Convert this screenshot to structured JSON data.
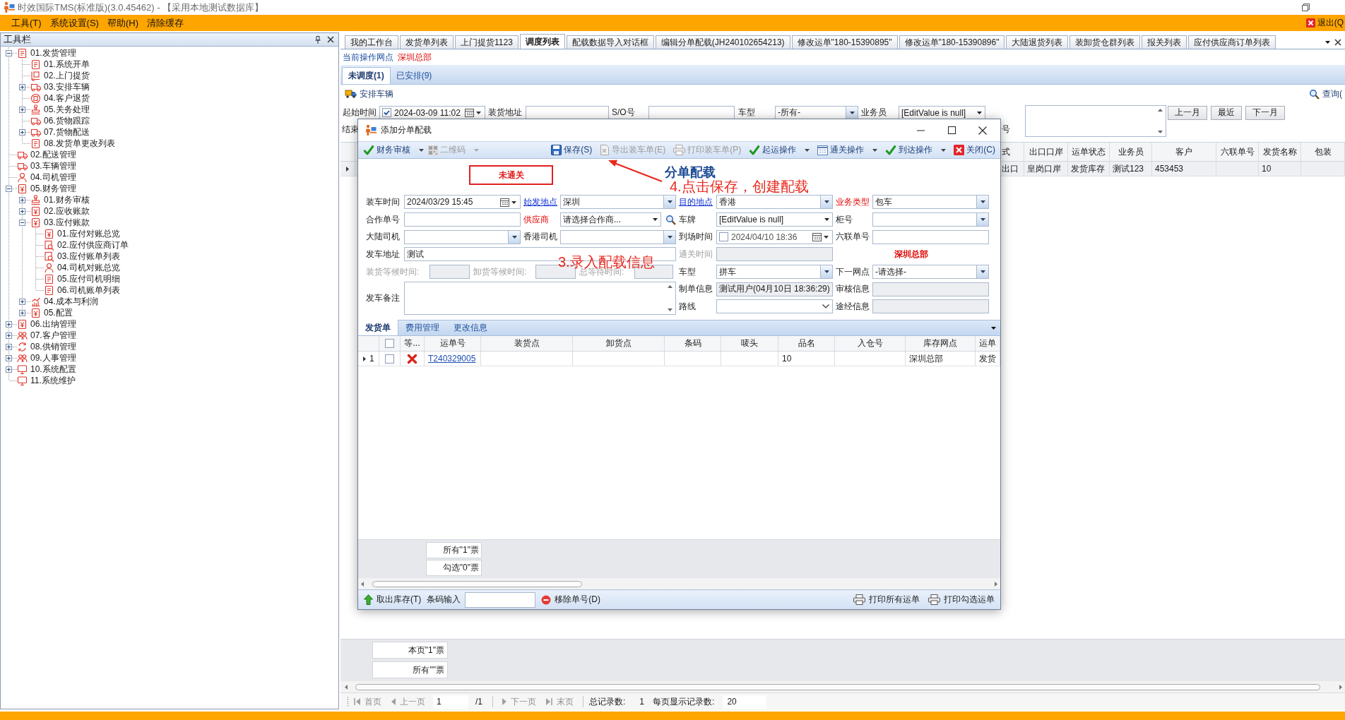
{
  "window": {
    "title": "时效国际TMS(标准版)(3.0.45462) - 【采用本地测试数据库】"
  },
  "menu": {
    "items": [
      "工具(T)",
      "系统设置(S)",
      "帮助(H)",
      "清除缓存"
    ],
    "exit": "退出(Q"
  },
  "toolbox": {
    "title": "工具栏",
    "tree": [
      {
        "label": "01.发货管理",
        "kind": "document",
        "expanded": true,
        "children": [
          {
            "label": "01.系统开单",
            "kind": "document"
          },
          {
            "label": "02.上门提货",
            "kind": "package"
          },
          {
            "label": "03.安排车辆",
            "kind": "truck",
            "expanded": false
          },
          {
            "label": "04.客户退货",
            "kind": "circle"
          },
          {
            "label": "05.关务处理",
            "kind": "stamp",
            "expanded": false
          },
          {
            "label": "06.货物跟踪",
            "kind": "truck"
          },
          {
            "label": "07.货物配送",
            "kind": "truck",
            "expanded": false
          },
          {
            "label": "08.发货单更改列表",
            "kind": "document"
          }
        ]
      },
      {
        "label": "02.配送管理",
        "kind": "truck"
      },
      {
        "label": "03.车辆管理",
        "kind": "truck"
      },
      {
        "label": "04.司机管理",
        "kind": "person"
      },
      {
        "label": "05.财务管理",
        "kind": "yen",
        "expanded": true,
        "children": [
          {
            "label": "01.财务审核",
            "kind": "stamp",
            "expanded": false
          },
          {
            "label": "02.应收账款",
            "kind": "yen",
            "expanded": false
          },
          {
            "label": "03.应付账款",
            "kind": "yen",
            "expanded": true,
            "children": [
              {
                "label": "01.应付对账总览",
                "kind": "yen"
              },
              {
                "label": "02.应付供应商订单",
                "kind": "search"
              },
              {
                "label": "03.应付账单列表",
                "kind": "search"
              },
              {
                "label": "04.司机对账总览",
                "kind": "person"
              },
              {
                "label": "05.应付司机明细",
                "kind": "document"
              },
              {
                "label": "06.司机账单列表",
                "kind": "document"
              }
            ]
          },
          {
            "label": "04.成本与利润",
            "kind": "chart",
            "expanded": false
          },
          {
            "label": "05.配置",
            "kind": "yen",
            "expanded": false
          }
        ]
      },
      {
        "label": "06.出纳管理",
        "kind": "yen",
        "expanded": false
      },
      {
        "label": "07.客户管理",
        "kind": "people",
        "expanded": false
      },
      {
        "label": "08.供销管理",
        "kind": "cycle",
        "expanded": false
      },
      {
        "label": "09.人事管理",
        "kind": "people",
        "expanded": false
      },
      {
        "label": "10.系统配置",
        "kind": "monitor",
        "expanded": false
      },
      {
        "label": "11.系统维护",
        "kind": "monitor"
      }
    ]
  },
  "tabs": [
    {
      "label": "我的工作台",
      "selected": false
    },
    {
      "label": "发货单列表",
      "selected": false
    },
    {
      "label": "上门提货1123",
      "selected": false
    },
    {
      "label": "调度列表",
      "selected": true
    },
    {
      "label": "配载数据导入对话框",
      "selected": false
    },
    {
      "label": "编辑分单配载(JH240102654213)",
      "selected": false
    },
    {
      "label": "修改运单\"180-15390895\"",
      "selected": false
    },
    {
      "label": "修改运单\"180-15390896\"",
      "selected": false
    },
    {
      "label": "大陆退货列表",
      "selected": false
    },
    {
      "label": "装卸货仓群列表",
      "selected": false
    },
    {
      "label": "报关列表",
      "selected": false
    },
    {
      "label": "应付供应商订单列表",
      "selected": false
    }
  ],
  "current_site": {
    "label": "当前操作网点",
    "value": "深圳总部"
  },
  "view_tabs": [
    {
      "label": "未调度(1)",
      "selected": true
    },
    {
      "label": "已安排(9)",
      "selected": false
    }
  ],
  "toolbar": {
    "arrange": "安排车辆",
    "query": "查询("
  },
  "filters": {
    "start": {
      "label": "起始时间",
      "kind": "date",
      "checked": true,
      "value": "2024-03-09 11:02"
    },
    "address": {
      "label": "装货地址",
      "kind": "text"
    },
    "so_number": {
      "label": "S/O号",
      "kind": "text"
    },
    "vehicle_type": {
      "label": "车型",
      "kind": "combo",
      "value": "-所有-"
    },
    "salesperson": {
      "label": "业务员",
      "kind": "dropdown",
      "value": "[EditValue is null]"
    },
    "end": {
      "label": "结束"
    },
    "number": {
      "label": "号",
      "kind": "memo"
    },
    "month_buttons": [
      "上一月",
      "最近",
      "下一月"
    ]
  },
  "grid": {
    "columns": [
      "式",
      "出口口岸",
      "运单状态",
      "业务员",
      "客户",
      "六联单号",
      "发货名称",
      "包装"
    ],
    "rows": [
      {
        "cells": [
          "出口",
          "皇岗口岸",
          "发货库存",
          "测试123",
          "453453",
          null,
          "10",
          null
        ]
      }
    ]
  },
  "summary": [
    "本页\"1\"票",
    "所有\"\"票"
  ],
  "pager": {
    "nav": [
      {
        "label": "首页",
        "kind": "first",
        "disabled": true
      },
      {
        "label": "上一页",
        "kind": "previous",
        "disabled": true
      },
      {
        "label": "下一页",
        "kind": "next",
        "disabled": true
      },
      {
        "label": "末页",
        "kind": "last",
        "disabled": true
      }
    ],
    "page": "1",
    "page_count": "/1",
    "total_label": "总记录数:",
    "total": "1",
    "page_size_label": "每页显示记录数:",
    "page_size": "20"
  },
  "dialog": {
    "title": "添加分单配载",
    "toolbar": [
      {
        "label": "财务审核",
        "kind": "check",
        "dropdown": true
      },
      {
        "label": "二维码",
        "kind": "qr",
        "disabled": true,
        "dropdown": true
      },
      {
        "label": "保存(S)",
        "kind": "save"
      },
      {
        "label": "导出装车单(E)",
        "kind": "export",
        "disabled": true
      },
      {
        "label": "打印装车单(P)",
        "kind": "print",
        "disabled": true
      },
      {
        "label": "起运操作",
        "kind": "check",
        "dropdown": true
      },
      {
        "label": "通关操作",
        "kind": "calendar",
        "dropdown": true
      },
      {
        "label": "到达操作",
        "kind": "check",
        "dropdown": true
      },
      {
        "label": "关闭(C)",
        "kind": "close"
      }
    ],
    "customs_status": "未通关",
    "heading": "分单配载",
    "form": {
      "load_time": {
        "label": "装车时间",
        "kind": "date",
        "value": "2024/03/29 15:45"
      },
      "origin": {
        "label": "始发地点",
        "link": true,
        "kind": "combo",
        "value": "深圳"
      },
      "destination": {
        "label": "目的地点",
        "link": true,
        "kind": "combo",
        "value": "香港"
      },
      "business_type": {
        "label": "业务类型",
        "required": true,
        "kind": "combo",
        "value": "包车"
      },
      "partner_no": {
        "label": "合作单号",
        "kind": "text"
      },
      "supplier": {
        "label": "供应商",
        "required": true,
        "kind": "dropdown",
        "value": "请选择合作商..."
      },
      "plate": {
        "label": "车牌",
        "kind": "dropdown",
        "value": "[EditValue is null]"
      },
      "container_no": {
        "label": "柜号",
        "kind": "combo"
      },
      "mainland_driver": {
        "label": "大陆司机",
        "kind": "combo"
      },
      "hk_driver": {
        "label": "香港司机",
        "kind": "combo"
      },
      "arrival_time": {
        "label": "到场时间",
        "kind": "date",
        "checked": false,
        "value": "2024/04/10 18:36"
      },
      "six_form_no": {
        "label": "六联单号",
        "kind": "text"
      },
      "departure_address": {
        "label": "发车地址",
        "kind": "text",
        "value": "测试"
      },
      "clearance_time": {
        "label": "通关时间",
        "kind": "text",
        "disabled": true
      },
      "site": "深圳总部",
      "waits": [
        {
          "label": "装货等候时间:",
          "disabled": true
        },
        {
          "label": "卸货等候时间:",
          "disabled": true
        },
        {
          "label": "总等待时间:",
          "disabled": true
        }
      ],
      "vehicle_type": {
        "label": "车型",
        "kind": "combo",
        "value": "拼车"
      },
      "next_site": {
        "label": "下一网点",
        "kind": "combo",
        "value": "-请选择-"
      },
      "remarks": {
        "label": "发车备注",
        "kind": "memo"
      },
      "creator_info": {
        "label": "制单信息",
        "kind": "text",
        "readonly": true,
        "value": "测试用户(04月10日 18:36:29)"
      },
      "review_info": {
        "label": "审核信息",
        "kind": "text",
        "readonly": true
      },
      "route": {
        "label": "路线",
        "kind": "select"
      },
      "via_info": {
        "label": "途经信息",
        "kind": "text",
        "readonly": true
      }
    },
    "annotations": [
      {
        "text": "4.点击保存，创建配载",
        "pointer": true
      },
      {
        "text": "3.录入配载信息"
      }
    ],
    "tabs": [
      {
        "label": "发货单",
        "selected": true
      },
      {
        "label": "费用管理",
        "selected": false
      },
      {
        "label": "更改信息",
        "selected": false
      }
    ],
    "grid": {
      "select_all": false,
      "columns": [
        "等...",
        "运单号",
        "装货点",
        "卸货点",
        "条码",
        "唛头",
        "品名",
        "入仓号",
        "库存网点",
        "运单"
      ],
      "rows": [
        {
          "number": "1",
          "checked": false,
          "status_ok": false,
          "cells": [
            null,
            "T240329005",
            null,
            null,
            null,
            null,
            "10",
            null,
            "深圳总部",
            "发货"
          ]
        }
      ]
    },
    "summary": [
      "所有\"1\"票",
      "勾选\"0\"票"
    ],
    "bottom_bar": {
      "take_out": "取出库存(T)",
      "barcode_label": "条码输入",
      "remove": "移除单号(D)",
      "print_all": "打印所有运单",
      "print_checked": "打印勾选运单"
    }
  }
}
